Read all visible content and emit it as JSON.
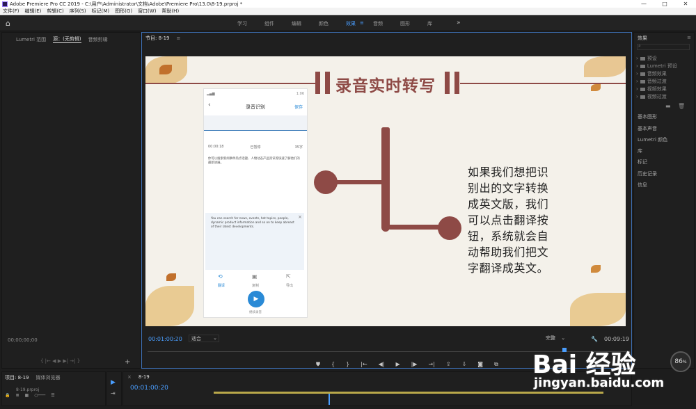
{
  "window": {
    "title": "Adobe Premiere Pro CC 2019 - C:\\用户\\Administrator\\文档\\Adobe\\Premiere Pro\\13.0\\8-19.prproj *",
    "controls": [
      "—",
      "□",
      "✕"
    ]
  },
  "menu": [
    "文件(F)",
    "编辑(E)",
    "剪辑(C)",
    "序列(S)",
    "标记(M)",
    "图形(G)",
    "窗口(W)",
    "帮助(H)"
  ],
  "workspaces": {
    "items": [
      "学习",
      "组件",
      "编辑",
      "颜色",
      "效果",
      "音频",
      "图形",
      "库"
    ],
    "active": "效果",
    "menu_glyph": "≡",
    "more": "»"
  },
  "source_panel": {
    "tabs": [
      "Lumetri 范围",
      "源：(无剪辑)",
      "音频剪辑"
    ],
    "active_tab": "源：(无剪辑)",
    "timecode": "00;00;00;00"
  },
  "program_monitor": {
    "tab": "节目: 8-19",
    "timecode": "00:01:00:20",
    "fit": "适合",
    "quality": "完整",
    "duration": "00:09:19"
  },
  "slide": {
    "title": "录音实时转写",
    "body": "如果我们想把识别出的文字转换成英文版，我们可以点击翻译按钮，系统就会自动帮助我们把文字翻译成英文。"
  },
  "phone": {
    "status_time": "1:06",
    "header_title": "录音识别",
    "save": "保存",
    "elapsed": "00:00:18",
    "state": "已暂停",
    "count": "35字",
    "cn_text": "你可以搜索新闻事件热点话题、人物动态产品资讯等快速了解他们的最新进展。",
    "en_text": "You can search for news, events, hot topics, people, dynamic product information and so on to keep abreast of their latest developments.",
    "actions": [
      "翻译",
      "复制",
      "导出"
    ],
    "record_label": "继续录音"
  },
  "effects_panel": {
    "title": "效果",
    "tree": [
      "预设",
      "Lumetri 预设",
      "音频效果",
      "音频过渡",
      "视频效果",
      "视频过渡"
    ],
    "sections": [
      "基本图形",
      "基本声音",
      "Lumetri 颜色",
      "库",
      "标记",
      "历史记录",
      "信息"
    ]
  },
  "project_panel": {
    "tabs": [
      "项目: 8-19",
      "媒体浏览器"
    ],
    "file": "8-19.prproj"
  },
  "timeline": {
    "tab": "8-19",
    "timecode": "00:01:00:20"
  },
  "watermark": {
    "brand": "Bai 经验",
    "url": "jingyan.baidu.com"
  },
  "badge": {
    "value": "86",
    "unit": "%"
  },
  "colors": {
    "accent": "#4a9eff",
    "slide_accent": "#8e4a46",
    "bg": "#1d1d1d"
  }
}
